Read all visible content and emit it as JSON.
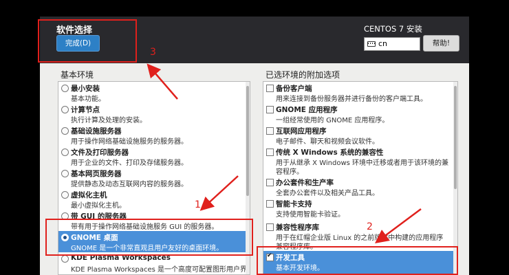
{
  "header": {
    "screen_title": "软件选择",
    "done_label": "完成(D)",
    "os_title": "CENTOS 7 安装",
    "lang_value": "cn",
    "help_label": "帮助!"
  },
  "left_panel": {
    "title": "基本环境",
    "items": [
      {
        "title": "最小安装",
        "desc": "基本功能。"
      },
      {
        "title": "计算节点",
        "desc": "执行计算及处理的安装。"
      },
      {
        "title": "基础设施服务器",
        "desc": "用于操作网络基础设施服务的服务器。"
      },
      {
        "title": "文件及打印服务器",
        "desc": "用于企业的文件、打印及存储服务器。"
      },
      {
        "title": "基本网页服务器",
        "desc": "提供静态及动态互联网内容的服务器。"
      },
      {
        "title": "虚拟化主机",
        "desc": "最小虚拟化主机。"
      },
      {
        "title": "带 GUI 的服务器",
        "desc": "带有用于操作网络基础设施服务 GUI 的服务器。"
      },
      {
        "title": "GNOME 桌面",
        "desc": "GNOME 是一个非常直观且用户友好的桌面环境。",
        "selected": true
      },
      {
        "title": "KDE Plasma Workspaces",
        "desc": "KDE Plasma Workspaces 是一个高度可配置图形用户界"
      }
    ]
  },
  "right_panel": {
    "title": "已选环境的附加选项",
    "items": [
      {
        "title": "备份客户端",
        "desc": "用来连接到备份服务器并进行备份的客户端工具。"
      },
      {
        "title": "GNOME 应用程序",
        "desc": "一组经常使用的 GNOME 应用程序。"
      },
      {
        "title": "互联网应用程序",
        "desc": "电子邮件、聊天和视频会议软件。"
      },
      {
        "title": "传统 X Windows 系统的兼容性",
        "desc": "用于从继承 X Windows 环境中迁移或者用于该环境的兼",
        "desc2": "容程序。"
      },
      {
        "title": "办公套件和生产率",
        "desc": "全套办公套件以及相关产品工具。"
      },
      {
        "title": "智能卡支持",
        "desc": "支持使用智能卡验证。"
      },
      {
        "title": "兼容性程序库",
        "desc": "用于在红帽企业版 Linux 的之前版本中构建的应用程序",
        "desc2": "兼容程序库。"
      },
      {
        "title": "开发工具",
        "desc": "基本开发环境。",
        "checked": true,
        "selected": true
      }
    ]
  },
  "annotations": {
    "label_1": "1",
    "label_2": "2",
    "label_3": "3"
  },
  "colors": {
    "header_bg": "#29292d",
    "accent_blue": "#2d80c6",
    "selection_blue": "#4a90d9",
    "annotation_red": "#e0201c"
  }
}
